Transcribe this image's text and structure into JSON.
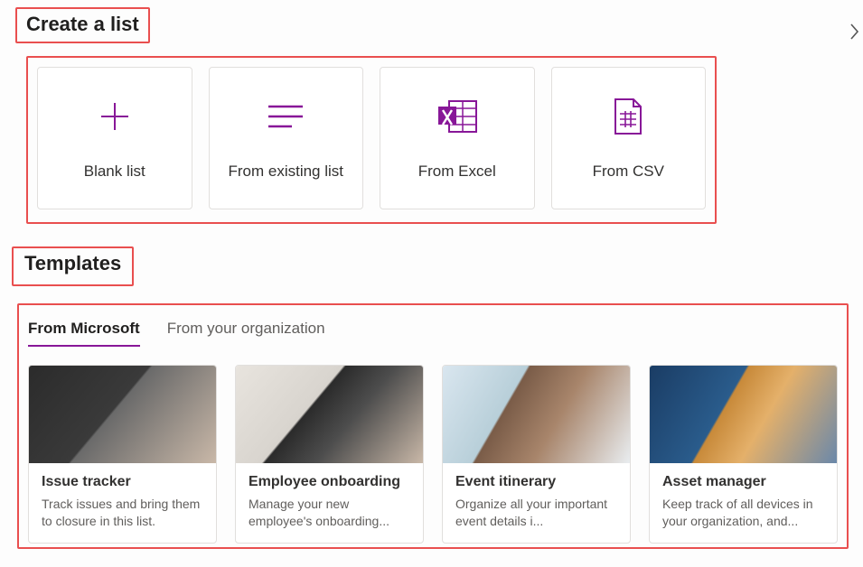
{
  "colors": {
    "accent": "#881798",
    "highlight": "#E94F4F"
  },
  "header": {
    "title": "Create a list"
  },
  "close_label": "×",
  "create_options": [
    {
      "label": "Blank list",
      "icon": "plus-icon"
    },
    {
      "label": "From existing list",
      "icon": "list-lines-icon"
    },
    {
      "label": "From Excel",
      "icon": "excel-icon"
    },
    {
      "label": "From CSV",
      "icon": "csv-file-icon"
    }
  ],
  "templates_header": "Templates",
  "tabs": [
    {
      "label": "From Microsoft",
      "active": true
    },
    {
      "label": "From your organization",
      "active": false
    }
  ],
  "templates": [
    {
      "title": "Issue tracker",
      "desc": "Track issues and bring them to closure in this list."
    },
    {
      "title": "Employee onboarding",
      "desc": "Manage your new employee's onboarding..."
    },
    {
      "title": "Event itinerary",
      "desc": "Organize all your important event details i..."
    },
    {
      "title": "Asset manager",
      "desc": "Keep track of all devices in your organization, and..."
    }
  ]
}
